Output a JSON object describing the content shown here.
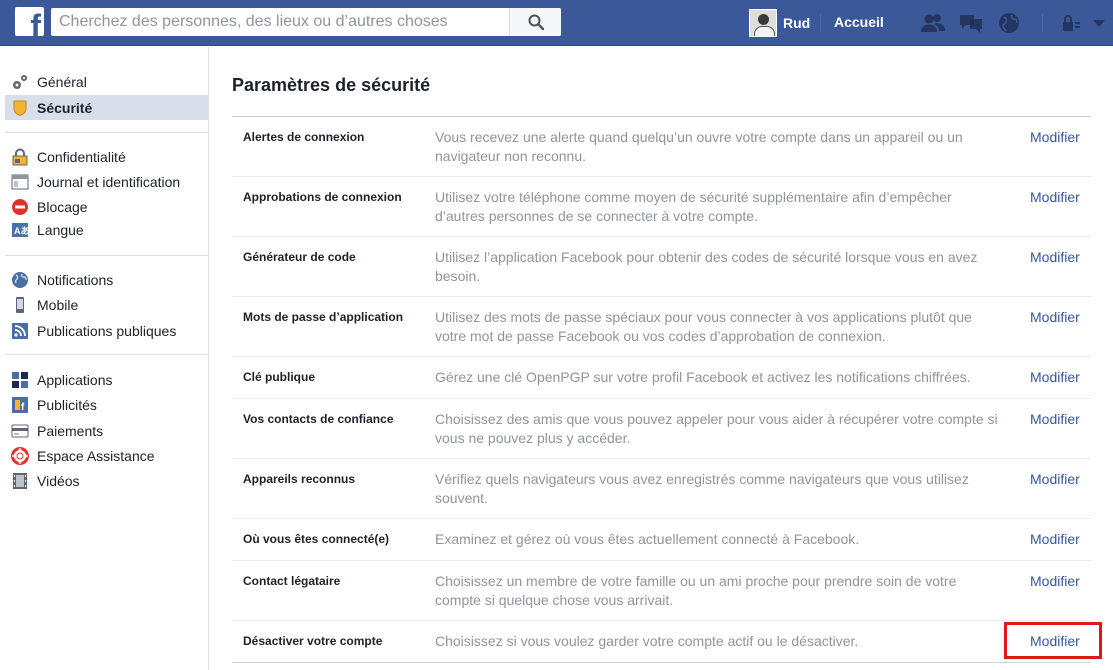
{
  "header": {
    "search_placeholder": "Cherchez des personnes, des lieux ou d’autres choses",
    "user_name": "Rud",
    "home_label": "Accueil",
    "icons": [
      "facebook-logo-icon",
      "search-icon",
      "friend-requests-icon",
      "messages-icon",
      "notifications-globe-icon",
      "privacy-lock-icon",
      "account-menu-caret-icon"
    ],
    "brand_color": "#3b5998"
  },
  "sidebar": {
    "groups": [
      [
        {
          "label": "Général",
          "icon": "gears-icon",
          "active": false
        },
        {
          "label": "Sécurité",
          "icon": "shield-icon",
          "active": true
        }
      ],
      [
        {
          "label": "Confidentialité",
          "icon": "privacy-lock-icon",
          "active": false
        },
        {
          "label": "Journal et identification",
          "icon": "timeline-icon",
          "active": false
        },
        {
          "label": "Blocage",
          "icon": "block-icon",
          "active": false
        },
        {
          "label": "Langue",
          "icon": "language-icon",
          "active": false
        }
      ],
      [
        {
          "label": "Notifications",
          "icon": "globe-icon",
          "active": false
        },
        {
          "label": "Mobile",
          "icon": "mobile-icon",
          "active": false
        },
        {
          "label": "Publications publiques",
          "icon": "rss-icon",
          "active": false
        }
      ],
      [
        {
          "label": "Applications",
          "icon": "apps-icon",
          "active": false
        },
        {
          "label": "Publicités",
          "icon": "ads-icon",
          "active": false
        },
        {
          "label": "Paiements",
          "icon": "payments-icon",
          "active": false
        },
        {
          "label": "Espace Assistance",
          "icon": "lifebuoy-icon",
          "active": false
        },
        {
          "label": "Vidéos",
          "icon": "film-icon",
          "active": false
        }
      ]
    ]
  },
  "main": {
    "title": "Paramètres de sécurité",
    "edit_label": "Modifier",
    "rows": [
      {
        "label": "Alertes de connexion",
        "desc": "Vous recevez une alerte quand quelqu’un ouvre votre compte dans un appareil ou un navigateur non reconnu."
      },
      {
        "label": "Approbations de connexion",
        "desc": "Utilisez votre téléphone comme moyen de sécurité supplémentaire afin d’empêcher d’autres personnes de se connecter à votre compte."
      },
      {
        "label": "Générateur de code",
        "desc": "Utilisez l’application Facebook pour obtenir des codes de sécurité lorsque vous en avez besoin."
      },
      {
        "label": "Mots de passe d’application",
        "desc": "Utilisez des mots de passe spéciaux pour vous connecter à vos applications plutôt que votre mot de passe Facebook ou vos codes d’approbation de connexion."
      },
      {
        "label": "Clé publique",
        "desc": "Gérez une clé OpenPGP sur votre profil Facebook et activez les notifications chiffrées."
      },
      {
        "label": "Vos contacts de confiance",
        "desc": "Choisissez des amis que vous pouvez appeler pour vous aider à récupérer votre compte si vous ne pouvez plus y accéder."
      },
      {
        "label": "Appareils reconnus",
        "desc": "Vérifiez quels navigateurs vous avez enregistrés comme navigateurs que vous utilisez souvent."
      },
      {
        "label": "Où vous êtes connecté(e)",
        "desc": "Examinez et gérez où vous êtes actuellement connecté à Facebook."
      },
      {
        "label": "Contact légataire",
        "desc": "Choisissez un membre de votre famille ou un ami proche pour prendre soin de votre compte si quelque chose vous arrivait."
      },
      {
        "label": "Désactiver votre compte",
        "desc": "Choisissez si vous voulez garder votre compte actif ou le désactiver."
      }
    ]
  }
}
